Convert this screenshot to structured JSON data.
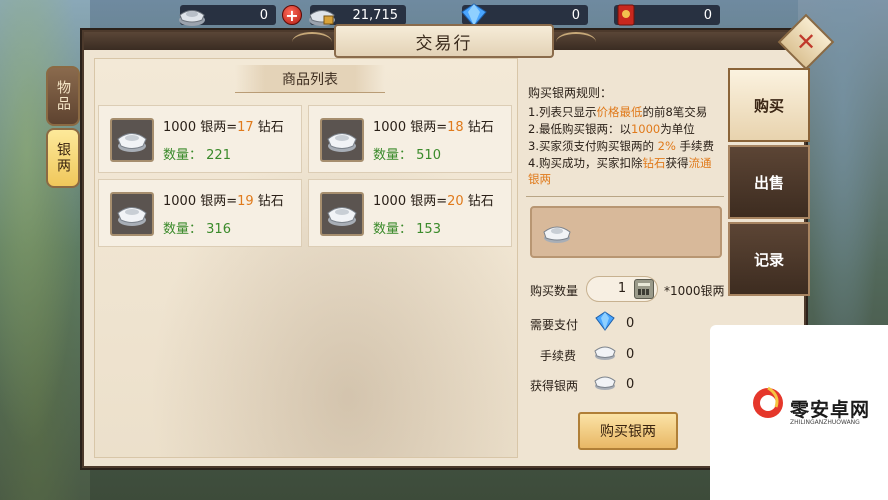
{
  "resources": {
    "silver": "0",
    "ingot": "21,715",
    "diamond": "0",
    "fu": "0"
  },
  "window": {
    "title": "交易行"
  },
  "left_tabs": [
    {
      "label": "物品",
      "active": false
    },
    {
      "label": "银两",
      "active": true
    }
  ],
  "right_tabs": [
    {
      "label": "购买",
      "active": true
    },
    {
      "label": "出售",
      "active": false
    },
    {
      "label": "记录",
      "active": false
    }
  ],
  "list": {
    "header": "商品列表",
    "silver_prefix": "1000 银两=",
    "diamond_suffix": " 钻石",
    "qty_label": "数量：",
    "items": [
      {
        "price": "17",
        "qty": "221"
      },
      {
        "price": "18",
        "qty": "510"
      },
      {
        "price": "19",
        "qty": "316"
      },
      {
        "price": "20",
        "qty": "153"
      }
    ]
  },
  "rules": {
    "title": "购买银两规则：",
    "line1_a": "1.列表只显示",
    "line1_hl": "价格最低",
    "line1_b": "的前8笔交易",
    "line2_a": "2.最低购买银两：以",
    "line2_hl": "1000",
    "line2_b": "为单位",
    "line3_a": "3.买家须支付购买银两的 ",
    "line3_hl": "2%",
    "line3_b": " 手续费",
    "line4_a": "4.购买成功，买家扣除",
    "line4_hl1": "钻石",
    "line4_b": "获得",
    "line4_hl2": "流通",
    "line5_hl": "银两"
  },
  "purchase": {
    "qty_label": "购买数量",
    "qty_value": "1",
    "unit": "*1000银两",
    "need_pay_label": "需要支付",
    "need_pay_value": "0",
    "fee_label": "手续费",
    "fee_value": "0",
    "gain_label": "获得银两",
    "gain_value": "0",
    "buy_button": "购买银两"
  },
  "watermark": {
    "name": "零安卓网",
    "sub": "ZHILINGANZHUOWANG"
  },
  "colors": {
    "highlight": "#e07a1b",
    "qty_green": "#3a8a2a",
    "panel_bg": "#efe4d2"
  }
}
